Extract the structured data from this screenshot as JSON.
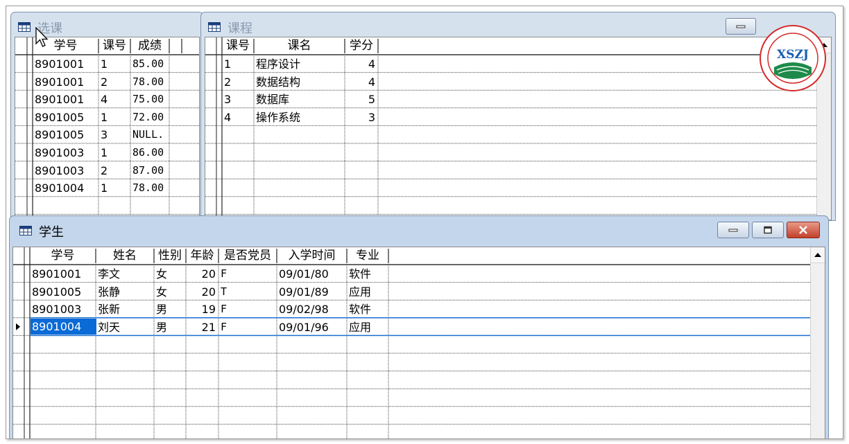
{
  "windows": {
    "xuanke": {
      "title": "选课",
      "headers": [
        "学号",
        "课号",
        "成绩"
      ],
      "rows": [
        [
          "8901001",
          "1",
          "85.00"
        ],
        [
          "8901001",
          "2",
          "78.00"
        ],
        [
          "8901001",
          "4",
          "75.00"
        ],
        [
          "8901005",
          "1",
          "72.00"
        ],
        [
          "8901005",
          "3",
          "NULL."
        ],
        [
          "8901003",
          "1",
          "86.00"
        ],
        [
          "8901003",
          "2",
          "87.00"
        ],
        [
          "8901004",
          "1",
          "78.00"
        ]
      ]
    },
    "kecheng": {
      "title": "课程",
      "headers": [
        "课号",
        "课名",
        "学分"
      ],
      "rows": [
        [
          "1",
          "程序设计",
          "4"
        ],
        [
          "2",
          "数据结构",
          "4"
        ],
        [
          "3",
          "数据库",
          "5"
        ],
        [
          "4",
          "操作系统",
          "3"
        ]
      ]
    },
    "xuesheng": {
      "title": "学生",
      "headers": [
        "学号",
        "姓名",
        "性别",
        "年龄",
        "是否党员",
        "入学时间",
        "专业"
      ],
      "rows": [
        [
          "8901001",
          "李文",
          "女",
          "20",
          "F",
          "09/01/80",
          "软件"
        ],
        [
          "8901005",
          "张静",
          "女",
          "20",
          "T",
          "09/01/89",
          "应用"
        ],
        [
          "8901003",
          "张新",
          "男",
          "19",
          "F",
          "09/02/98",
          "软件"
        ],
        [
          "8901004",
          "刘天",
          "男",
          "21",
          "F",
          "09/01/96",
          "应用"
        ]
      ],
      "selected_row": 3
    }
  },
  "logo": {
    "text": "XSZJ",
    "colors": {
      "ring": "#d42a2a",
      "text": "#1a5fb0",
      "water": "#1e8a4a"
    }
  },
  "colors": {
    "selection": "#0a6ad6",
    "grid": "#555555",
    "titlebar": "#c9d9ea"
  }
}
